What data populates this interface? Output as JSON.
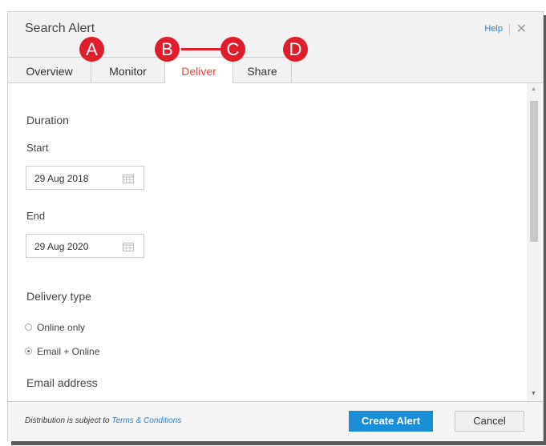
{
  "dialog": {
    "title": "Search Alert",
    "help_label": "Help",
    "close_glyph": "✕"
  },
  "tabs": [
    {
      "label": "Overview",
      "active": false
    },
    {
      "label": "Monitor",
      "active": false
    },
    {
      "label": "Deliver",
      "active": true
    },
    {
      "label": "Share",
      "active": false
    }
  ],
  "annotations": {
    "markers": [
      "A",
      "B",
      "C",
      "D"
    ],
    "color": "#e01e2a"
  },
  "form": {
    "duration_heading": "Duration",
    "start_label": "Start",
    "start_value": "29 Aug 2018",
    "end_label": "End",
    "end_value": "29 Aug 2020",
    "delivery_type_label": "Delivery type",
    "delivery_options": [
      {
        "label": "Online only",
        "selected": false
      },
      {
        "label": "Email + Online",
        "selected": true
      }
    ],
    "email_label": "Email address"
  },
  "footer": {
    "distribution_text": "Distribution is subject to ",
    "terms_link": "Terms & Conditions",
    "create_label": "Create Alert",
    "cancel_label": "Cancel"
  },
  "colors": {
    "accent": "#1a8fd8",
    "active_tab": "#e8463c",
    "link": "#2a7fc7"
  },
  "icons": {
    "calendar": "calendar-icon",
    "close": "close-icon",
    "scroll_up": "scroll-up-arrow-icon",
    "scroll_down": "scroll-down-arrow-icon"
  }
}
